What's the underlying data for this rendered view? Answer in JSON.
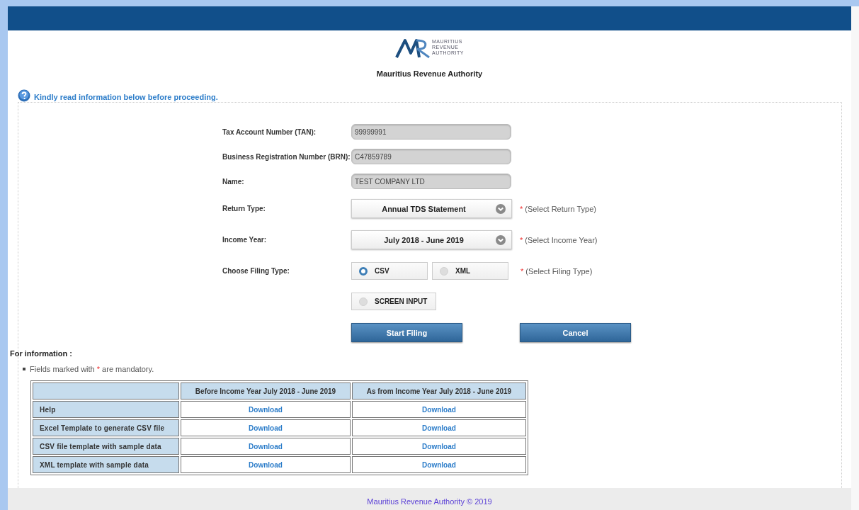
{
  "logo": {
    "lines": [
      "MAURITIUS",
      "REVENUE",
      "AUTHORITY"
    ]
  },
  "org_name": "Mauritius Revenue Authority",
  "notice": "Kindly read information below before proceeding.",
  "form": {
    "fields": [
      {
        "kind": "readonly",
        "label": "Tax Account Number (TAN):",
        "value": "99999991"
      },
      {
        "kind": "readonly",
        "label": "Business Registration Number (BRN):",
        "value": "C47859789"
      },
      {
        "kind": "readonly",
        "label": "Name:",
        "value": "TEST COMPANY LTD"
      },
      {
        "kind": "select",
        "label": "Return Type:",
        "value": "Annual TDS Statement",
        "mark": "*",
        "hint": "(Select Return Type)"
      },
      {
        "kind": "select",
        "label": "Income Year:",
        "value": "July 2018 - June 2019",
        "mark": "*",
        "hint": "(Select Income Year)"
      },
      {
        "kind": "radio",
        "label": "Choose Filing Type:",
        "mark": "*",
        "hint": "(Select Filing Type)",
        "options": [
          {
            "label": "CSV",
            "selected": true
          },
          {
            "label": "XML",
            "selected": false
          },
          {
            "label": "SCREEN INPUT",
            "selected": false
          }
        ]
      }
    ],
    "buttons": [
      "Start Filing",
      "Cancel"
    ]
  },
  "info": {
    "title": "For information :",
    "note": {
      "before": "Fields marked with",
      "mark": "*",
      "after": "are mandatory."
    },
    "table": {
      "columns": [
        "Before Income Year July 2018 - June 2019",
        "As from Income Year July 2018 - June 2019"
      ],
      "rows": [
        {
          "label": "Help",
          "cells": [
            "Download",
            "Download"
          ]
        },
        {
          "label": "Excel Template to generate CSV file",
          "cells": [
            "Download",
            "Download"
          ]
        },
        {
          "label": "CSV file template with sample data",
          "cells": [
            "Download",
            "Download"
          ]
        },
        {
          "label": "XML template with sample data",
          "cells": [
            "Download",
            "Download"
          ]
        }
      ]
    }
  },
  "footer": "Mauritius Revenue Authority © 2019"
}
